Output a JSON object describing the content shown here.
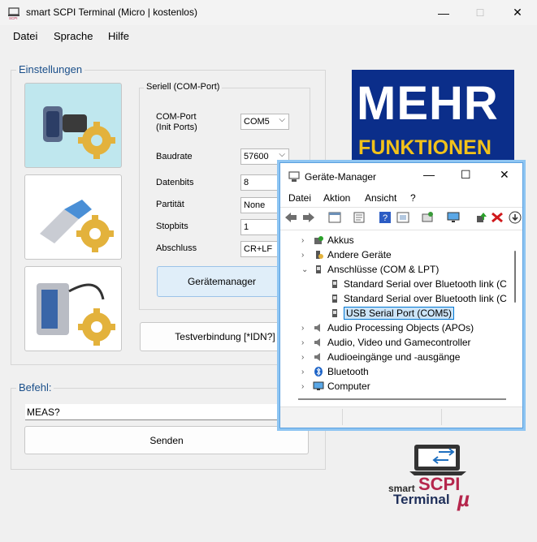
{
  "app": {
    "title": "smart SCPI Terminal (Micro | kostenlos)",
    "window_controls": {
      "minimize": "—",
      "maximize": "☐",
      "close": "✕"
    }
  },
  "menu": {
    "items": [
      "Datei",
      "Sprache",
      "Hilfe"
    ]
  },
  "settings": {
    "group_title": "Einstellungen",
    "serial_group_title": "Seriell (COM-Port)",
    "fields": [
      {
        "label": "COM-Port\n(Init Ports)",
        "value": "COM5"
      },
      {
        "label": "Baudrate",
        "value": "57600"
      },
      {
        "label": "Datenbits",
        "value": "8"
      },
      {
        "label": "Partität",
        "value": "None"
      },
      {
        "label": "Stopbits",
        "value": "1"
      },
      {
        "label": "Abschluss",
        "value": "CR+LF"
      }
    ],
    "device_manager_button": "Gerätemanager",
    "test_button": "Testverbindung [*IDN?]"
  },
  "command": {
    "group_title": "Befehl:",
    "input_value": "MEAS?",
    "send_button": "Senden"
  },
  "banner": {
    "line1": "MEHR",
    "line2": "FUNKTIONEN",
    "bg": "#0b2e8a",
    "line2_color": "#f2c21a"
  },
  "logo": {
    "smart": "smart",
    "scpi": "SCPI",
    "terminal": "Terminal",
    "mu": "µ",
    "accent": "#b5264c",
    "dark": "#2a2a2a"
  },
  "device_manager": {
    "title": "Geräte-Manager",
    "menu": [
      "Datei",
      "Aktion",
      "Ansicht",
      "?"
    ],
    "tree": [
      {
        "label": "Akkus",
        "level": 1,
        "expanded": false
      },
      {
        "label": "Andere Geräte",
        "level": 1,
        "expanded": false
      },
      {
        "label": "Anschlüsse (COM & LPT)",
        "level": 1,
        "expanded": true
      },
      {
        "label": "Standard Serial over Bluetooth link (C",
        "level": 2
      },
      {
        "label": "Standard Serial over Bluetooth link (C",
        "level": 2
      },
      {
        "label": "USB Serial Port (COM5)",
        "level": 2,
        "selected": true
      },
      {
        "label": "Audio Processing Objects (APOs)",
        "level": 1,
        "expanded": false
      },
      {
        "label": "Audio, Video und Gamecontroller",
        "level": 1,
        "expanded": false
      },
      {
        "label": "Audioeingänge und -ausgänge",
        "level": 1,
        "expanded": false
      },
      {
        "label": "Bluetooth",
        "level": 1,
        "expanded": false
      },
      {
        "label": "Computer",
        "level": 1,
        "expanded": false
      }
    ],
    "accent": "#0078d4"
  }
}
